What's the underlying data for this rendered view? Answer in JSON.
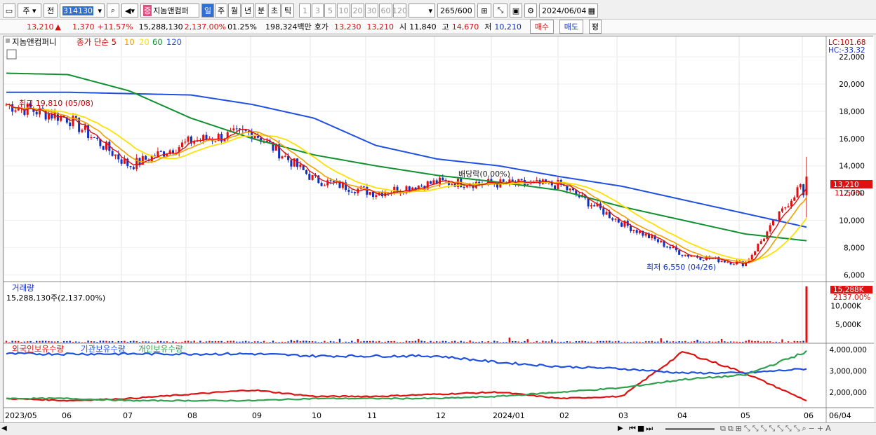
{
  "toolbar": {
    "market": "주",
    "period_prefix": "전",
    "code": "314130",
    "name": "지놈앤컴퍼",
    "name_badge": "증",
    "tabs": [
      "일",
      "주",
      "월",
      "년",
      "분",
      "초",
      "틱"
    ],
    "active_tab": "일",
    "intervals": [
      "1",
      "3",
      "5",
      "10",
      "20",
      "30",
      "60",
      "120"
    ],
    "count": "265",
    "count_max": "/600",
    "date": "2024/06/04"
  },
  "quote": {
    "price": "13,210",
    "arrow": "▲",
    "change": "1,370",
    "pct": "+11.57%",
    "volume": "15,288,130",
    "vol_pct": "2,137.00%",
    "turnover": "01.25%",
    "amount": "198,324백만",
    "bid_label": "호가",
    "bid1": "13,230",
    "bid2": "13,210",
    "open_label": "시",
    "open": "11,840",
    "high_label": "고",
    "high": "14,670",
    "low_label": "저",
    "low": "10,210",
    "buy": "매수",
    "sell": "매도",
    "eval": "평"
  },
  "price_pane": {
    "stock": "지놈앤컴퍼니",
    "ma_label": "종가 단순",
    "ma_periods": [
      "5",
      "10",
      "20",
      "60",
      "120"
    ],
    "lc": "LC:101.68",
    "hc": "HC:-33.32",
    "y_ticks": [
      "22,000",
      "20,000",
      "18,000",
      "16,000",
      "14,000",
      "12,000",
      "10,000",
      "8,000",
      "6,000"
    ],
    "cur_price": "13,210",
    "cur_pct": "11.57%",
    "high_ann": "최고 19,810 (05/08)",
    "low_ann": "최저 6,550 (04/26)",
    "dividend_ann": "배당락(0.00%)"
  },
  "volume_pane": {
    "title": "거래량",
    "info": "15,288,130주(2,137.00%)",
    "y_ticks": [
      "10,000K",
      "5,000K"
    ],
    "cur": "15,288K",
    "cur_pct": "2137.00%"
  },
  "holding_pane": {
    "legend": [
      "외국인보유수량",
      "기관보유수량",
      "개인보유수량"
    ],
    "y_ticks": [
      "4,000,000",
      "3,000,000",
      "2,000,000"
    ]
  },
  "x_axis": {
    "labels": [
      "2023/05",
      "06",
      "07",
      "08",
      "09",
      "10",
      "11",
      "12",
      "2024/01",
      "02",
      "03",
      "04",
      "05",
      "06",
      "06/04"
    ]
  },
  "colors": {
    "ma5": "#e01010",
    "ma10": "#f0a000",
    "ma20": "#ffe000",
    "ma60": "#109030",
    "ma120": "#2050e0",
    "up": "#e01010",
    "down": "#1030c0",
    "foreign": "#e01010",
    "inst": "#2050e0",
    "indiv": "#30a050"
  },
  "chart_data": [
    {
      "type": "candlestick",
      "title": "지놈앤컴퍼니",
      "ylim": [
        5500,
        23500
      ],
      "series": [
        {
          "name": "120",
          "values_by_month": [
            19400,
            19400,
            19300,
            19200,
            18500,
            17500,
            15500,
            14500,
            14000,
            13200,
            12500,
            11500,
            10500,
            9500
          ]
        },
        {
          "name": "60",
          "values_by_month": [
            20800,
            20700,
            19500,
            17500,
            16000,
            14800,
            14000,
            13300,
            12800,
            12200,
            11000,
            10000,
            9000,
            8500
          ]
        },
        {
          "name": "close_by_month",
          "values": [
            18500,
            17500,
            14000,
            15800,
            16500,
            13000,
            12000,
            12800,
            12700,
            12600,
            9800,
            7500,
            6800,
            13210
          ]
        }
      ]
    },
    {
      "type": "bar",
      "title": "거래량",
      "last_value": 15288130
    },
    {
      "type": "line",
      "series": [
        {
          "name": "외국인보유수량",
          "values": [
            1700000,
            1600000,
            1700000,
            1900000,
            2100000,
            1800000,
            1800000,
            1900000,
            2000000,
            1700000,
            1800000,
            3900000,
            2900000,
            1600000
          ]
        },
        {
          "name": "기관보유수량",
          "values": [
            3800000,
            3800000,
            3800000,
            3800000,
            3800000,
            3700000,
            3700000,
            3700000,
            3400000,
            3200000,
            3100000,
            2900000,
            2900000,
            3100000
          ]
        },
        {
          "name": "개인보유수량",
          "values": [
            1700000,
            1700000,
            1600000,
            1600000,
            1600000,
            1700000,
            1700000,
            1700000,
            1800000,
            2000000,
            2200000,
            2600000,
            2800000,
            3900000
          ]
        }
      ]
    }
  ]
}
